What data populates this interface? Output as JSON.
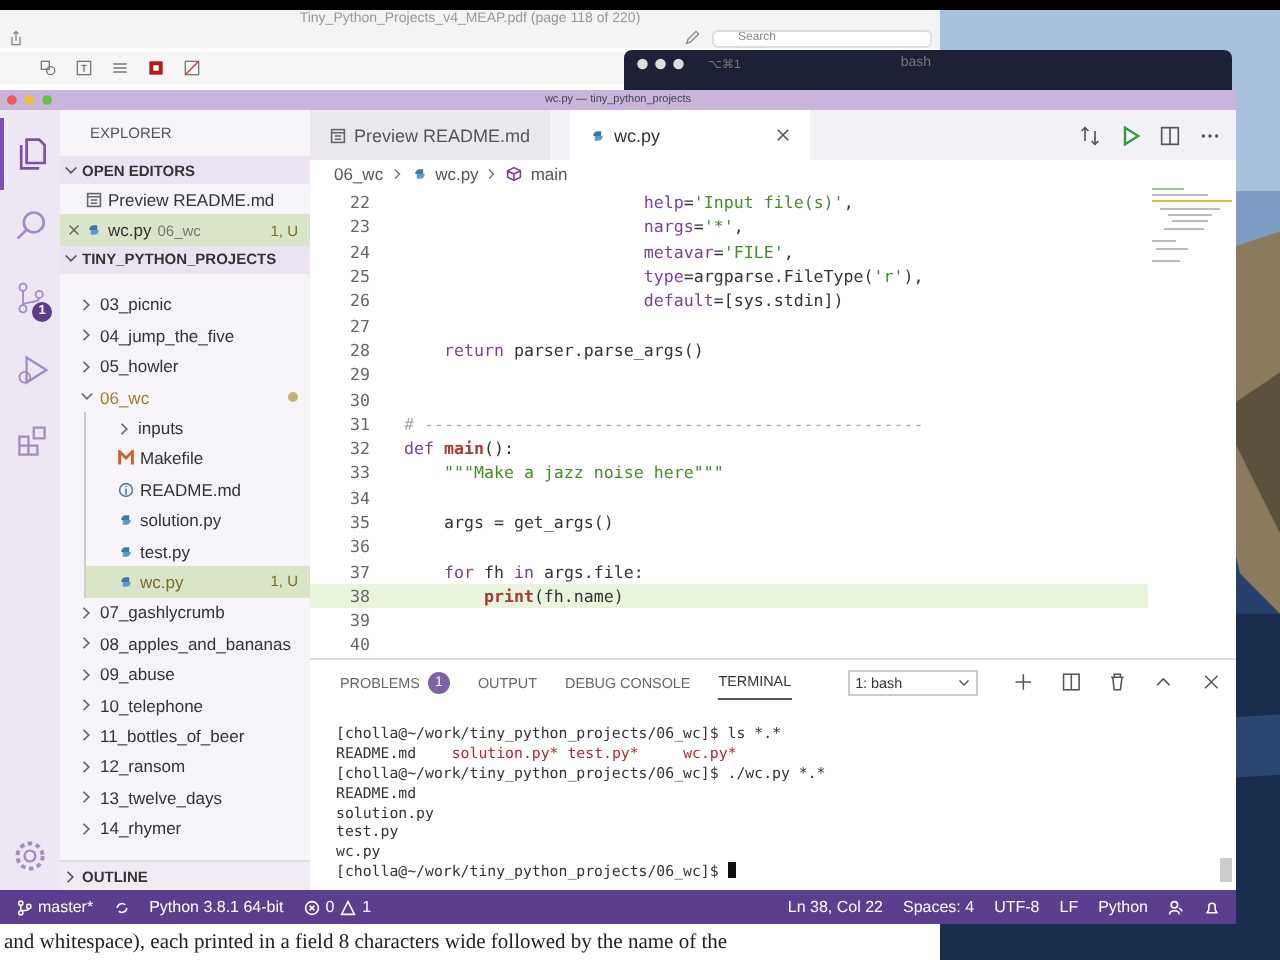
{
  "pdf_window": {
    "title": "Tiny_Python_Projects_v4_MEAP.pdf (page 118 of 220)",
    "search_placeholder": "Search",
    "body_text": "and whitespace), each printed in a field 8 characters wide followed by the name of the"
  },
  "terminal_window": {
    "shortcut": "⌥⌘1",
    "title": "bash"
  },
  "vscode": {
    "title": "wc.py — tiny_python_projects",
    "activity": [
      {
        "kind": "files",
        "selected": true
      },
      {
        "kind": "search",
        "selected": false
      },
      {
        "kind": "scm",
        "selected": false,
        "badge": "1"
      },
      {
        "kind": "debug",
        "selected": false
      },
      {
        "kind": "extensions",
        "selected": false
      }
    ],
    "sidebar": {
      "title": "EXPLORER",
      "open_editors": {
        "title": "OPEN EDITORS",
        "expanded": true,
        "items": [
          {
            "label": "Preview README.md",
            "kind": "preview",
            "selected": false
          },
          {
            "label": "wc.py",
            "kind": "python",
            "folder": "06_wc",
            "badge": "1, U",
            "selected": true
          }
        ]
      },
      "project": {
        "title": "TINY_PYTHON_PROJECTS",
        "expanded": true,
        "items": [
          {
            "label": "03_picnic",
            "kind": "folder",
            "expanded": false,
            "selected": false
          },
          {
            "label": "04_jump_the_five",
            "kind": "folder",
            "expanded": false,
            "selected": false
          },
          {
            "label": "05_howler",
            "kind": "folder",
            "expanded": false,
            "selected": false
          },
          {
            "label": "06_wc",
            "kind": "folder",
            "expanded": true,
            "selected": false,
            "modified": true,
            "children": [
              {
                "label": "inputs",
                "kind": "folder",
                "expanded": false,
                "selected": false
              },
              {
                "label": "Makefile",
                "kind": "makefile",
                "selected": false
              },
              {
                "label": "README.md",
                "kind": "markdown",
                "selected": false
              },
              {
                "label": "solution.py",
                "kind": "python",
                "selected": false
              },
              {
                "label": "test.py",
                "kind": "python",
                "selected": false
              },
              {
                "label": "wc.py",
                "kind": "python",
                "selected": true,
                "badge": "1, U"
              }
            ]
          },
          {
            "label": "07_gashlycrumb",
            "kind": "folder",
            "expanded": false,
            "selected": false
          },
          {
            "label": "08_apples_and_bananas",
            "kind": "folder",
            "expanded": false,
            "selected": false
          },
          {
            "label": "09_abuse",
            "kind": "folder",
            "expanded": false,
            "selected": false
          },
          {
            "label": "10_telephone",
            "kind": "folder",
            "expanded": false,
            "selected": false
          },
          {
            "label": "11_bottles_of_beer",
            "kind": "folder",
            "expanded": false,
            "selected": false
          },
          {
            "label": "12_ransom",
            "kind": "folder",
            "expanded": false,
            "selected": false
          },
          {
            "label": "13_twelve_days",
            "kind": "folder",
            "expanded": false,
            "selected": false
          },
          {
            "label": "14_rhymer",
            "kind": "folder",
            "expanded": false,
            "selected": false
          }
        ]
      },
      "outline": {
        "title": "OUTLINE",
        "expanded": false
      }
    },
    "tabs": [
      {
        "label": "Preview README.md",
        "kind": "preview",
        "selected": false
      },
      {
        "label": "wc.py",
        "kind": "python",
        "selected": true
      }
    ],
    "breadcrumbs": [
      {
        "label": "06_wc",
        "kind": "folder"
      },
      {
        "label": "wc.py",
        "kind": "python"
      },
      {
        "label": "main",
        "kind": "symbol"
      }
    ],
    "code": [
      {
        "number": "22",
        "highlighted": false,
        "tokens": [
          {
            "kind": "param",
            "text": "                        help"
          },
          {
            "kind": "plain",
            "text": "="
          },
          {
            "kind": "str",
            "text": "'Input file(s)'"
          },
          {
            "kind": "plain",
            "text": ","
          }
        ]
      },
      {
        "number": "23",
        "highlighted": false,
        "tokens": [
          {
            "kind": "param",
            "text": "                        nargs"
          },
          {
            "kind": "plain",
            "text": "="
          },
          {
            "kind": "str",
            "text": "'*'"
          },
          {
            "kind": "plain",
            "text": ","
          }
        ]
      },
      {
        "number": "24",
        "highlighted": false,
        "tokens": [
          {
            "kind": "param",
            "text": "                        metavar"
          },
          {
            "kind": "plain",
            "text": "="
          },
          {
            "kind": "str",
            "text": "'FILE'"
          },
          {
            "kind": "plain",
            "text": ","
          }
        ]
      },
      {
        "number": "25",
        "highlighted": false,
        "tokens": [
          {
            "kind": "param",
            "text": "                        type"
          },
          {
            "kind": "plain",
            "text": "=argparse.FileType("
          },
          {
            "kind": "str",
            "text": "'r'"
          },
          {
            "kind": "plain",
            "text": "),"
          }
        ]
      },
      {
        "number": "26",
        "highlighted": false,
        "tokens": [
          {
            "kind": "param",
            "text": "                        default"
          },
          {
            "kind": "plain",
            "text": "=[sys.stdin])"
          }
        ]
      },
      {
        "number": "27",
        "highlighted": false
      },
      {
        "number": "28",
        "highlighted": false,
        "tokens": [
          {
            "kind": "kw",
            "text": "    return"
          },
          {
            "kind": "plain",
            "text": " parser.parse_args()"
          }
        ]
      },
      {
        "number": "29",
        "highlighted": false
      },
      {
        "number": "30",
        "highlighted": false
      },
      {
        "number": "31",
        "highlighted": false,
        "tokens": [
          {
            "kind": "comment",
            "text": "# --------------------------------------------------"
          }
        ]
      },
      {
        "number": "32",
        "highlighted": false,
        "tokens": [
          {
            "kind": "kw",
            "text": "def "
          },
          {
            "kind": "fn",
            "text": "main"
          },
          {
            "kind": "plain",
            "text": "():"
          }
        ]
      },
      {
        "number": "33",
        "highlighted": false,
        "tokens": [
          {
            "kind": "str",
            "text": "    \"\"\"Make a jazz noise here\"\"\""
          }
        ]
      },
      {
        "number": "34",
        "highlighted": false
      },
      {
        "number": "35",
        "highlighted": false,
        "tokens": [
          {
            "kind": "plain",
            "text": "    args = get_args()"
          }
        ]
      },
      {
        "number": "36",
        "highlighted": false
      },
      {
        "number": "37",
        "highlighted": false,
        "tokens": [
          {
            "kind": "kw",
            "text": "    for"
          },
          {
            "kind": "plain",
            "text": " fh "
          },
          {
            "kind": "kw",
            "text": "in"
          },
          {
            "kind": "plain",
            "text": " args.file:"
          }
        ]
      },
      {
        "number": "38",
        "highlighted": true,
        "tokens": [
          {
            "kind": "fn",
            "text": "        print"
          },
          {
            "kind": "plain",
            "text": "(fh.name)"
          }
        ]
      },
      {
        "number": "39",
        "highlighted": false
      },
      {
        "number": "40",
        "highlighted": false
      }
    ],
    "panel": {
      "tabs": [
        {
          "label": "PROBLEMS",
          "badge": "1",
          "selected": false
        },
        {
          "label": "OUTPUT",
          "selected": false
        },
        {
          "label": "DEBUG CONSOLE",
          "selected": false
        },
        {
          "label": "TERMINAL",
          "selected": true
        }
      ],
      "terminal_select": "1: bash",
      "terminal_lines": [
        [
          {
            "kind": "plain",
            "text": "[cholla@~/work/tiny_python_projects/06_wc]$ ls *.*"
          }
        ],
        [
          {
            "kind": "plain",
            "text": "README.md    "
          },
          {
            "kind": "exec",
            "text": "solution.py* "
          },
          {
            "kind": "exec",
            "text": "test.py*     "
          },
          {
            "kind": "exec",
            "text": "wc.py*"
          }
        ],
        [
          {
            "kind": "plain",
            "text": "[cholla@~/work/tiny_python_projects/06_wc]$ ./wc.py *.*"
          }
        ],
        [
          {
            "kind": "plain",
            "text": "README.md"
          }
        ],
        [
          {
            "kind": "plain",
            "text": "solution.py"
          }
        ],
        [
          {
            "kind": "plain",
            "text": "test.py"
          }
        ],
        [
          {
            "kind": "plain",
            "text": "wc.py"
          }
        ],
        [
          {
            "kind": "plain",
            "text": "[cholla@~/work/tiny_python_projects/06_wc]$ "
          },
          {
            "kind": "cursor"
          }
        ]
      ]
    },
    "status": {
      "branch": "master*",
      "interpreter": "Python 3.8.1 64-bit",
      "errors": "0",
      "warnings": "1",
      "right": [
        "Ln 38, Col 22",
        "Spaces: 4",
        "UTF-8",
        "LF",
        "Python"
      ]
    }
  }
}
